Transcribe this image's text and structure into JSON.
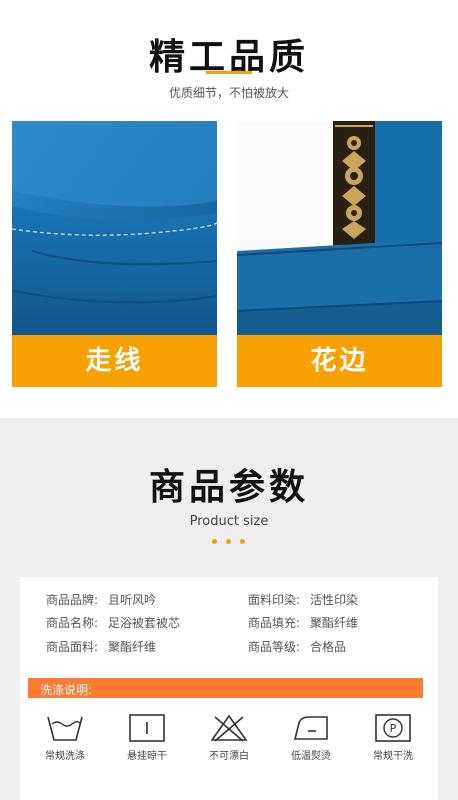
{
  "quality": {
    "title": "精工品质",
    "subtitle": "优质细节，不怕被放大",
    "panels": [
      {
        "label": "走线"
      },
      {
        "label": "花边"
      }
    ]
  },
  "params": {
    "title": "商品参数",
    "subtitle": "Product size",
    "rows": [
      {
        "label": "商品品牌:",
        "value": "且听风吟"
      },
      {
        "label": "面料印染:",
        "value": "活性印染"
      },
      {
        "label": "商品名称:",
        "value": "足浴被套被芯"
      },
      {
        "label": "商品填充:",
        "value": "聚酯纤维"
      },
      {
        "label": "商品面料:",
        "value": "聚酯纤维"
      },
      {
        "label": "商品等级:",
        "value": "合格品"
      }
    ],
    "wash": {
      "title": "洗涤说明:",
      "icons": [
        {
          "name": "wash-tub-icon",
          "label": "常规洗涤"
        },
        {
          "name": "hang-dry-icon",
          "label": "悬挂晾干"
        },
        {
          "name": "no-bleach-icon",
          "label": "不可漂白"
        },
        {
          "name": "low-iron-icon",
          "label": "低温熨烫"
        },
        {
          "name": "dry-clean-icon",
          "label": "常规干洗",
          "symbol": "P"
        }
      ]
    }
  },
  "colors": {
    "accent_orange": "#f7a000",
    "wash_bar": "#ff7a33",
    "fabric_blue": "#1a6fa8",
    "background_gray": "#efefef"
  }
}
